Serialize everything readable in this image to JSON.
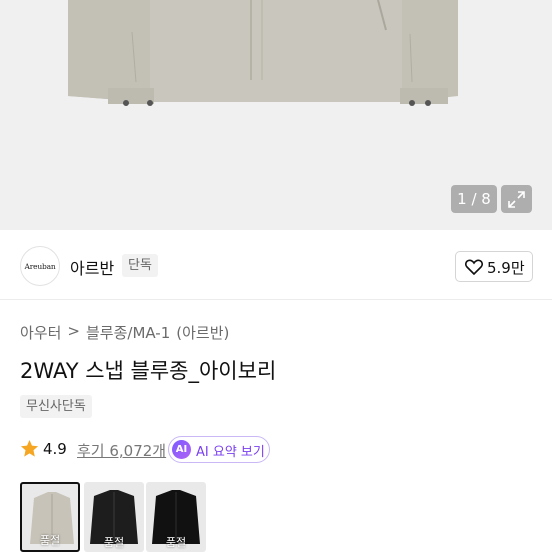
{
  "gallery": {
    "counter": "1 / 8",
    "expand_icon": "expand-icon"
  },
  "brand": {
    "logo_text": "Areuban",
    "name": "아르반",
    "tag": "단독",
    "like_count": "5.9만",
    "like_icon": "heart-icon"
  },
  "breadcrumb": {
    "items": [
      "아우터",
      ">",
      "블루종/MA-1",
      "(아르반)"
    ]
  },
  "product": {
    "title": "2WAY 스냅 블루종_아이보리",
    "exclusive_badge": "무신사단독"
  },
  "rating": {
    "score": "4.9",
    "reviews": "후기 6,072개",
    "ai_icon_text": "AI",
    "ai_button": "AI 요약 보기",
    "accent": "#7a3ff0",
    "star_color": "#f5a623"
  },
  "thumbnails": [
    {
      "label": "품절",
      "color": "#c7c3b8",
      "selected": true
    },
    {
      "label": "품절",
      "color": "#1d1d1d",
      "selected": false
    },
    {
      "label": "품절",
      "color": "#111111",
      "selected": false
    }
  ]
}
